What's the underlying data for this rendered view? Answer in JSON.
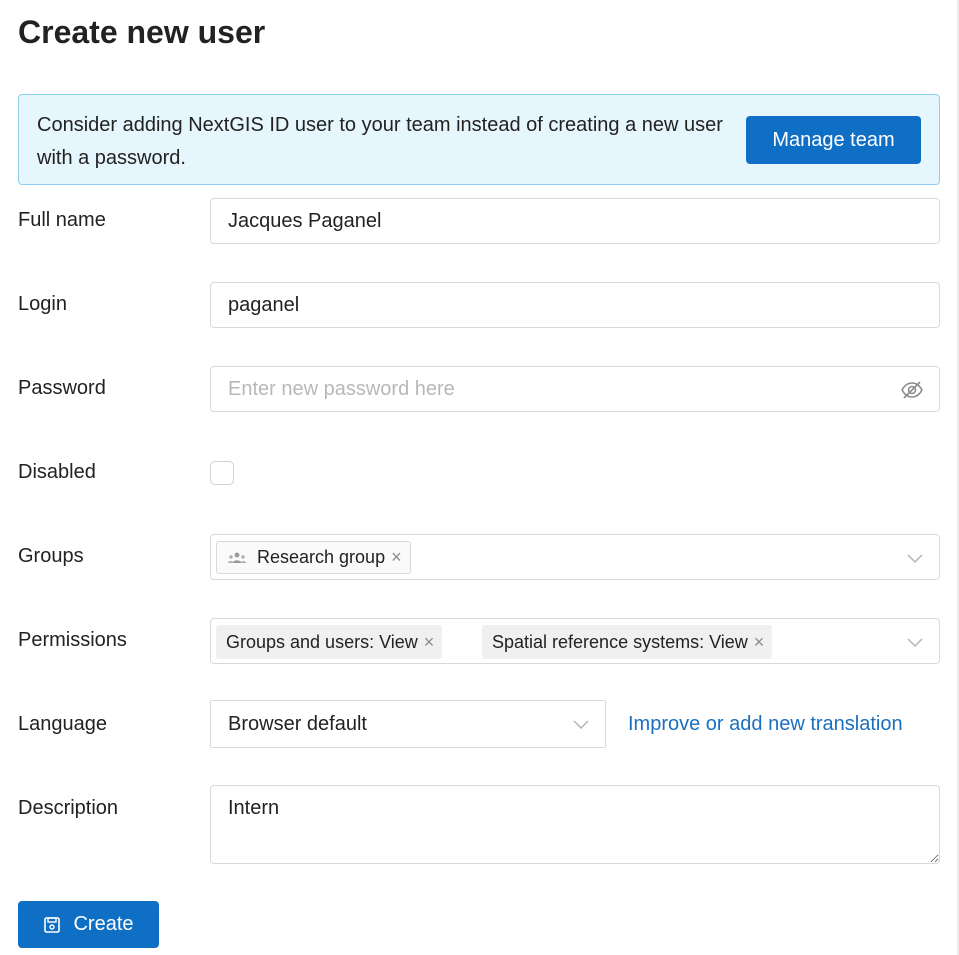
{
  "page_title": "Create new user",
  "banner": {
    "text": "Consider adding NextGIS ID user to your team instead of creating a new user with a password.",
    "button_label": "Manage team"
  },
  "fields": {
    "full_name": {
      "label": "Full name",
      "value": "Jacques Paganel"
    },
    "login": {
      "label": "Login",
      "value": "paganel"
    },
    "password": {
      "label": "Password",
      "value": "",
      "placeholder": "Enter new password here"
    },
    "disabled": {
      "label": "Disabled",
      "checked": false
    },
    "groups": {
      "label": "Groups",
      "tags": [
        "Research group"
      ]
    },
    "permissions": {
      "label": "Permissions",
      "tags": [
        "Groups and users: View",
        "Spatial reference systems: View"
      ]
    },
    "language": {
      "label": "Language",
      "value": "Browser default",
      "link": "Improve or add new translation"
    },
    "description": {
      "label": "Description",
      "value": "Intern"
    }
  },
  "create_button_label": "Create",
  "colors": {
    "primary": "#0f6fc4",
    "banner_bg": "#e6f6fd",
    "banner_border": "#8ccfef",
    "link": "#1a6fc0"
  },
  "icons": {
    "password_toggle": "eye-invisible-icon",
    "group_tag": "team-icon",
    "tag_remove": "close-icon",
    "select_open": "chevron-down-icon",
    "create": "save-icon"
  }
}
